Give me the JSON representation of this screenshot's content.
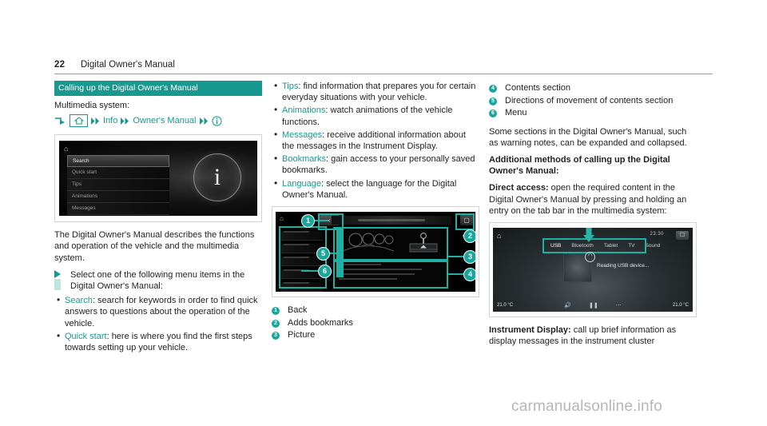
{
  "header": {
    "page_number": "22",
    "title": "Digital Owner's Manual"
  },
  "left_column": {
    "section_title": "Calling up the Digital Owner's Manual",
    "multimedia_label": "Multimedia system:",
    "breadcrumb": {
      "arrow_icon": "turn-arrow-icon",
      "home_icon": "home-icon",
      "sep_icon": "double-chevron-icon",
      "item1": "Info",
      "item2": "Owner's Manual",
      "end_icon": "info-circle-icon"
    },
    "screenshot_menu": {
      "home_icon": "home-icon",
      "items": [
        "Search",
        "Quick start",
        "Tips",
        "Animations",
        "Messages"
      ],
      "selected": "Search",
      "info_glyph": "i"
    },
    "intro_paragraph": "The Digital Owner's Manual describes the functions and operation of the vehicle and the multimedia system.",
    "step": "Select one of the following menu items in the Digital Owner's Manual:",
    "bullets": [
      {
        "term": "Search",
        "text": ": search for keywords in order to find quick answers to questions about the operation of the vehicle."
      },
      {
        "term": "Quick start",
        "text": ": here is where you find the first steps towards setting up your vehicle."
      }
    ]
  },
  "middle_column": {
    "bullets": [
      {
        "term": "Tips",
        "text": ": find information that prepares you for certain everyday situations with your vehicle."
      },
      {
        "term": "Animations",
        "text": ": watch animations of the vehicle functions."
      },
      {
        "term": "Messages",
        "text": ": receive additional information about the messages in the Instrument Display."
      },
      {
        "term": "Bookmarks",
        "text": ": gain access to your personally saved bookmarks."
      },
      {
        "term": "Language",
        "text": ": select the language for the Digital Owner's Manual."
      }
    ],
    "diagram": {
      "home_icon": "home-icon",
      "back_icon": "back-chevron-icon",
      "bookmark_icon": "bookmark-icon",
      "callouts": [
        "1",
        "2",
        "3",
        "4",
        "5",
        "6"
      ]
    },
    "legend": [
      {
        "num": "1",
        "label": "Back"
      },
      {
        "num": "2",
        "label": "Adds bookmarks"
      },
      {
        "num": "3",
        "label": "Picture"
      }
    ]
  },
  "right_column": {
    "legend": [
      {
        "num": "4",
        "label": "Contents section"
      },
      {
        "num": "5",
        "label": "Directions of movement of contents section"
      },
      {
        "num": "6",
        "label": "Menu"
      }
    ],
    "paragraph1": "Some sections in the Digital Owner's Manual, such as warning notes, can be expanded and collapsed.",
    "heading_bold": "Additional methods of calling up the Digital Owner's Manual:",
    "direct_access_label": "Direct access:",
    "direct_access_text": " open the required content in the Digital Owner's Manual by pressing and holding an entry on the tab bar in the multimedia system:",
    "screenshot_usb": {
      "home_icon": "home-icon",
      "status_text": "23:30",
      "message_icon": "message-icon",
      "tabs": [
        "USB",
        "Bluetooth",
        "Tablet",
        "TV",
        "Sound"
      ],
      "active_tab": "USB",
      "reading_text": "Reading USB device...",
      "temp_left": "21.0 °C",
      "temp_right": "21.0 °C",
      "arrow_icon": "down-arrow-icon"
    },
    "instrument_label": "Instrument Display:",
    "instrument_text": " call up brief information as display messages in the instrument cluster"
  },
  "watermark": "carmanualsonline.info",
  "colors": {
    "accent_teal": "#18998f",
    "overlay_teal": "#1fb0a4",
    "badge_teal": "#1aa79b"
  }
}
